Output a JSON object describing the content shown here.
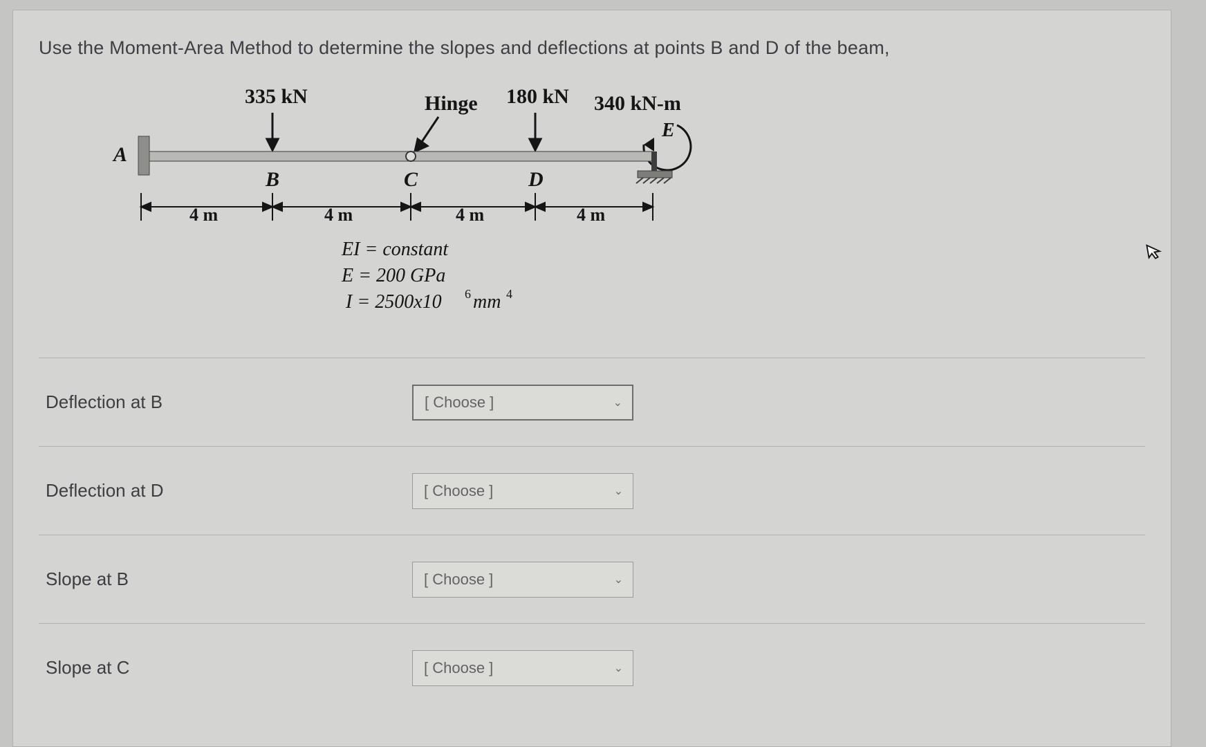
{
  "prompt": "Use the Moment-Area Method to determine the slopes and deflections at points B and D of the beam,",
  "figure": {
    "load1": "335 kN",
    "hinge": "Hinge",
    "load2": "180 kN",
    "moment": "340 kN-m",
    "A": "A",
    "B": "B",
    "C": "C",
    "D": "D",
    "E": "E",
    "d1": "4 m",
    "d2": "4 m",
    "d3": "4 m",
    "d4": "4 m",
    "eq1": "EI = constant",
    "eq2": "E = 200 GPa",
    "eq3_left": "I = 2500x10",
    "eq3_sup": "6",
    "eq3_right": "mm",
    "eq3_sup2": "4"
  },
  "rows": [
    {
      "label": "Deflection at B",
      "placeholder": "[ Choose ]"
    },
    {
      "label": "Deflection at D",
      "placeholder": "[ Choose ]"
    },
    {
      "label": "Slope at B",
      "placeholder": "[ Choose ]"
    },
    {
      "label": "Slope at C",
      "placeholder": "[ Choose ]"
    }
  ]
}
